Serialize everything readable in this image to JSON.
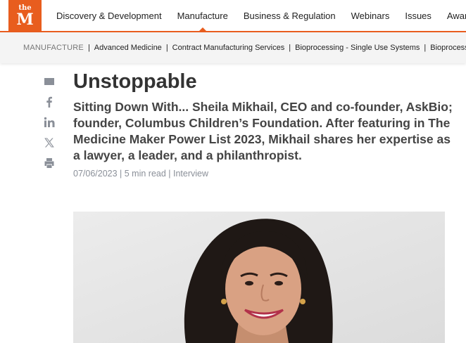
{
  "logo": {
    "line1": "the",
    "line2": "M"
  },
  "nav": {
    "items": [
      {
        "label": "Discovery & Development"
      },
      {
        "label": "Manufacture"
      },
      {
        "label": "Business & Regulation"
      },
      {
        "label": "Webinars"
      },
      {
        "label": "Issues"
      },
      {
        "label": "Awards"
      }
    ]
  },
  "breadcrumb": {
    "section": "MANUFACTURE",
    "items": [
      "Advanced Medicine",
      "Contract Manufacturing Services",
      "Bioprocessing - Single Use Systems",
      "Bioprocessing"
    ]
  },
  "share": [
    "email-icon",
    "facebook-icon",
    "linkedin-icon",
    "x-icon",
    "print-icon"
  ],
  "article": {
    "title": "Unstoppable",
    "subtitle": "Sitting Down With... Sheila Mikhail, CEO and co-founder, AskBio; founder, Columbus Children’s Foundation. After featuring in The Medicine Maker Power List 2023, Mikhail shares her expertise as a lawyer, a leader, and a philanthropist.",
    "meta": "07/06/2023 | 5 min read | Interview"
  },
  "colors": {
    "brand": "#e85d1e",
    "muted": "#8a8f98"
  }
}
